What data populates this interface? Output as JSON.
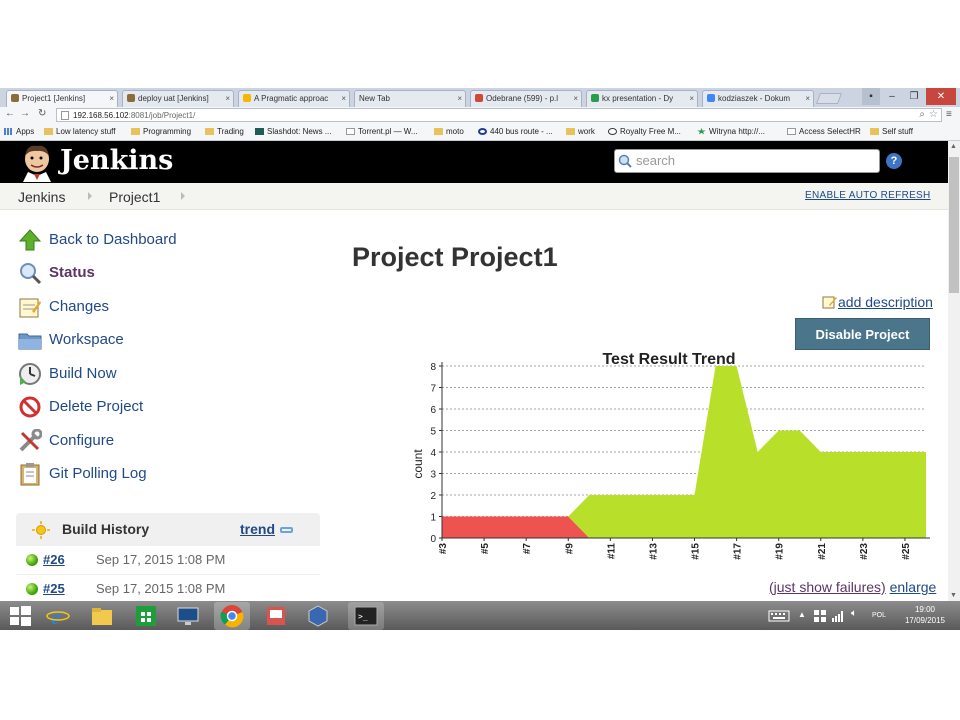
{
  "browser": {
    "tabs": [
      {
        "label": "Project1 [Jenkins]",
        "active": true,
        "favicon_color": "#8a6d3b"
      },
      {
        "label": "deploy uat [Jenkins]",
        "active": false,
        "favicon_color": "#8a6d3b"
      },
      {
        "label": "A Pragmatic approac",
        "active": false,
        "favicon_color": "#f5b800"
      },
      {
        "label": "New Tab",
        "active": false,
        "favicon_color": ""
      },
      {
        "label": "Odebrane (599) - p.l",
        "active": false,
        "favicon_color": "#d44638"
      },
      {
        "label": "kx presentation - Dy",
        "active": false,
        "favicon_color": "#2a9d4a"
      },
      {
        "label": "kodziaszek - Dokum",
        "active": false,
        "favicon_color": "#4285f4"
      }
    ],
    "url_host": "192.168.56.102",
    "url_path": ":8081/job/Project1/",
    "bookmarks": [
      {
        "label": "Apps",
        "icon": "apps-grid-icon"
      },
      {
        "label": "Low latency stuff",
        "icon": "folder-icon"
      },
      {
        "label": "Programming",
        "icon": "folder-icon"
      },
      {
        "label": "Trading",
        "icon": "folder-icon"
      },
      {
        "label": "Slashdot: News ...",
        "icon": "slashdot-icon"
      },
      {
        "label": "Torrent.pl — W...",
        "icon": "page-icon"
      },
      {
        "label": "moto",
        "icon": "folder-icon"
      },
      {
        "label": "440 bus route - ...",
        "icon": "tfl-icon"
      },
      {
        "label": "work",
        "icon": "folder-icon"
      },
      {
        "label": "Royalty Free M...",
        "icon": "info-icon"
      },
      {
        "label": "Witryna http://...",
        "icon": "star-icon"
      },
      {
        "label": "Access SelectHR",
        "icon": "page-icon"
      },
      {
        "label": "Self stuff",
        "icon": "folder-icon"
      }
    ]
  },
  "jenkins": {
    "logo_text": "Jenkins",
    "search_placeholder": "search",
    "help_label": "?",
    "breadcrumbs": [
      "Jenkins",
      "Project1"
    ],
    "auto_refresh": "ENABLE AUTO REFRESH",
    "tasks": [
      {
        "label": "Back to Dashboard",
        "icon": "up-arrow-icon"
      },
      {
        "label": "Status",
        "icon": "search-icon"
      },
      {
        "label": "Changes",
        "icon": "notepad-icon"
      },
      {
        "label": "Workspace",
        "icon": "folder-icon"
      },
      {
        "label": "Build Now",
        "icon": "clock-icon"
      },
      {
        "label": "Delete Project",
        "icon": "no-entry-icon"
      },
      {
        "label": "Configure",
        "icon": "tools-icon"
      },
      {
        "label": "Git Polling Log",
        "icon": "clipboard-icon"
      }
    ],
    "build_history": {
      "title": "Build History",
      "trend": "trend",
      "builds": [
        {
          "number": "#26",
          "date": "Sep 17, 2015 1:08 PM"
        },
        {
          "number": "#25",
          "date": "Sep 17, 2015 1:08 PM"
        }
      ]
    },
    "page_title": "Project Project1",
    "add_description": "add description",
    "disable_button": "Disable Project",
    "just_show_failures": "(just show failures)",
    "enlarge": "enlarge"
  },
  "chart_data": {
    "type": "area",
    "title": "Test Result Trend",
    "ylabel": "count",
    "ylim": [
      0,
      8
    ],
    "yticks": [
      0,
      1,
      2,
      3,
      4,
      5,
      6,
      7,
      8
    ],
    "x": [
      3,
      4,
      5,
      6,
      7,
      8,
      9,
      10,
      11,
      12,
      13,
      14,
      15,
      16,
      17,
      18,
      19,
      20,
      21,
      22,
      23,
      24,
      25,
      26
    ],
    "xtick_labels": [
      "#3",
      "#5",
      "#7",
      "#9",
      "#11",
      "#13",
      "#15",
      "#17",
      "#19",
      "#21",
      "#23",
      "#25"
    ],
    "series": [
      {
        "values": [
          1,
          1,
          1,
          1,
          1,
          1,
          1,
          0,
          0,
          0,
          0,
          0,
          0,
          0,
          0,
          0,
          0,
          0,
          0,
          0,
          0,
          0,
          0,
          0
        ],
        "color": "#ef5350"
      },
      {
        "values": [
          0,
          0,
          0,
          0,
          0,
          0,
          0,
          2,
          2,
          2,
          2,
          2,
          2,
          8,
          8,
          4,
          5,
          5,
          4,
          4,
          4,
          4,
          4,
          4
        ],
        "color": "#b8e02a"
      }
    ],
    "grid": true
  },
  "os": {
    "tray_lang": "POL",
    "time": "19:00",
    "date": "17/09/2015"
  }
}
